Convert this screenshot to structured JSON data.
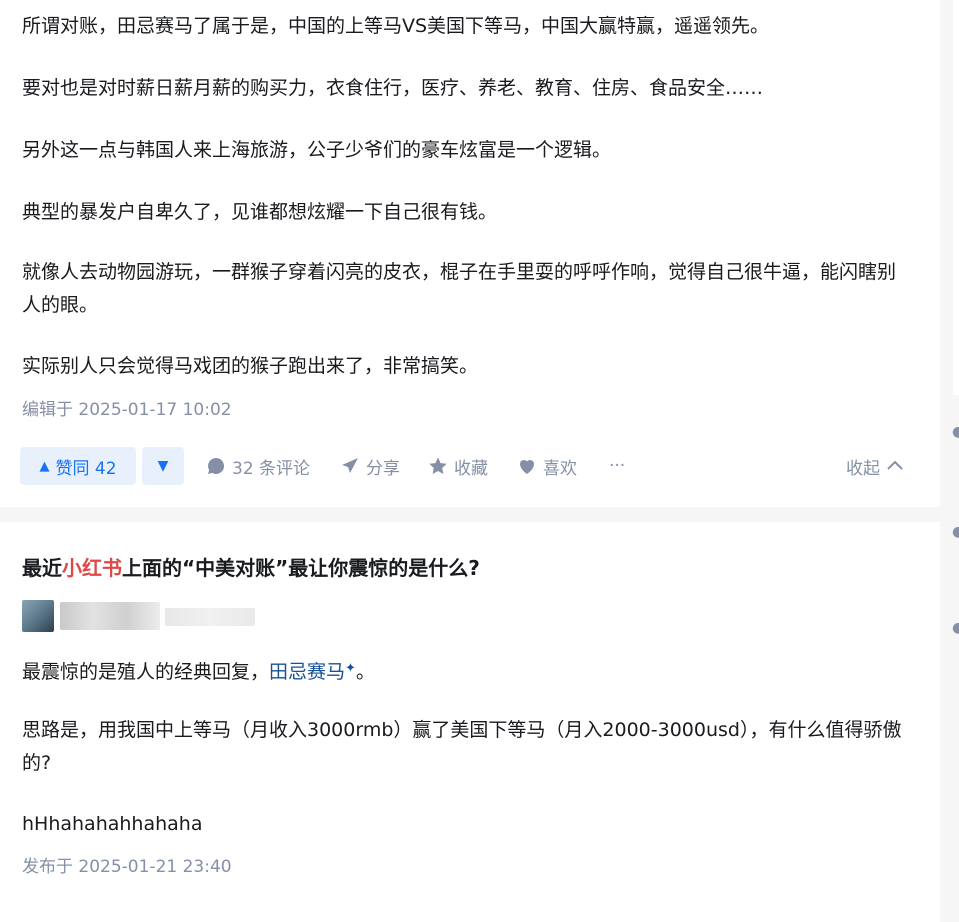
{
  "answer1": {
    "paragraphs": [
      "所谓对账，田忌赛马了属于是，中国的上等马VS美国下等马，中国大赢特赢，遥遥领先。",
      "要对也是对时薪日薪月薪的购买力，衣食住行，医疗、养老、教育、住房、食品安全……",
      "另外这一点与韩国人来上海旅游，公子少爷们的豪车炫富是一个逻辑。",
      "典型的暴发户自卑久了，见谁都想炫耀一下自己很有钱。",
      "就像人去动物园游玩，一群猴子穿着闪亮的皮衣，棍子在手里耍的呼呼作响，觉得自己很牛逼，能闪瞎别人的眼。",
      "实际别人只会觉得马戏团的猴子跑出来了，非常搞笑。"
    ],
    "edited": "编辑于 2025-01-17 10:02",
    "actions": {
      "upvote": "赞同 42",
      "comments": "32 条评论",
      "share": "分享",
      "favorite": "收藏",
      "like": "喜欢",
      "more": "···",
      "collapse": "收起"
    }
  },
  "answer2": {
    "title_prefix": "最近",
    "title_highlight": "小红书",
    "title_suffix": "上面的“中美对账”最让你震惊的是什么?",
    "p1_prefix": "最震惊的是殖人的经典回复，",
    "p1_link": "田忌赛马",
    "p1_suffix": "。",
    "p2": "思路是，用我国中上等马（月收入3000rmb）赢了美国下等马（月入2000-3000usd），有什么值得骄傲的?",
    "p3": "hHhahahahhahaha",
    "published": "发布于 2025-01-21 23:40"
  },
  "colors": {
    "accent": "#1772f6",
    "muted": "#8590a6",
    "highlight_red": "#e04848",
    "link": "#175199"
  }
}
